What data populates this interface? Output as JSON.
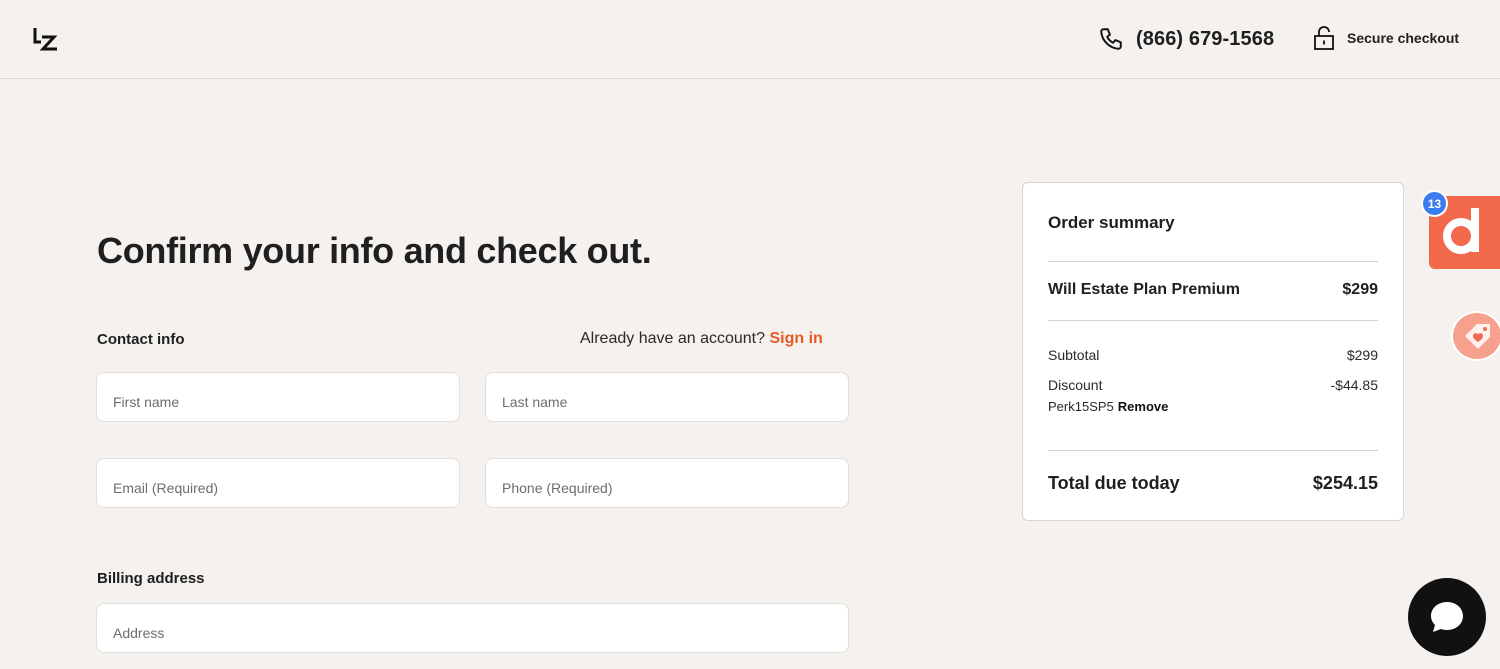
{
  "header": {
    "logo_text": "LZ",
    "phone": "(866) 679-1568",
    "secure_label": "Secure checkout"
  },
  "main": {
    "title": "Confirm your info and check out.",
    "contact_label": "Contact info",
    "account_prompt": "Already have an account?",
    "sign_in": "Sign in",
    "fields": {
      "first_name": "First name",
      "last_name": "Last name",
      "email": "Email (Required)",
      "phone": "Phone (Required)",
      "address": "Address"
    },
    "billing_label": "Billing address"
  },
  "summary": {
    "title": "Order summary",
    "product_name": "Will Estate Plan Premium",
    "product_price": "$299",
    "subtotal_label": "Subtotal",
    "subtotal_value": "$299",
    "discount_label": "Discount",
    "discount_value": "-$44.85",
    "promo_code": "Perk15SP5",
    "remove_label": "Remove",
    "total_label": "Total due today",
    "total_value": "$254.15"
  },
  "widgets": {
    "d_badge_count": "13",
    "d_letter": "d"
  },
  "colors": {
    "accent": "#e8592a",
    "background": "#f4f1ee",
    "widget_orange": "#f26a4b",
    "badge_blue": "#3b7cf0"
  }
}
